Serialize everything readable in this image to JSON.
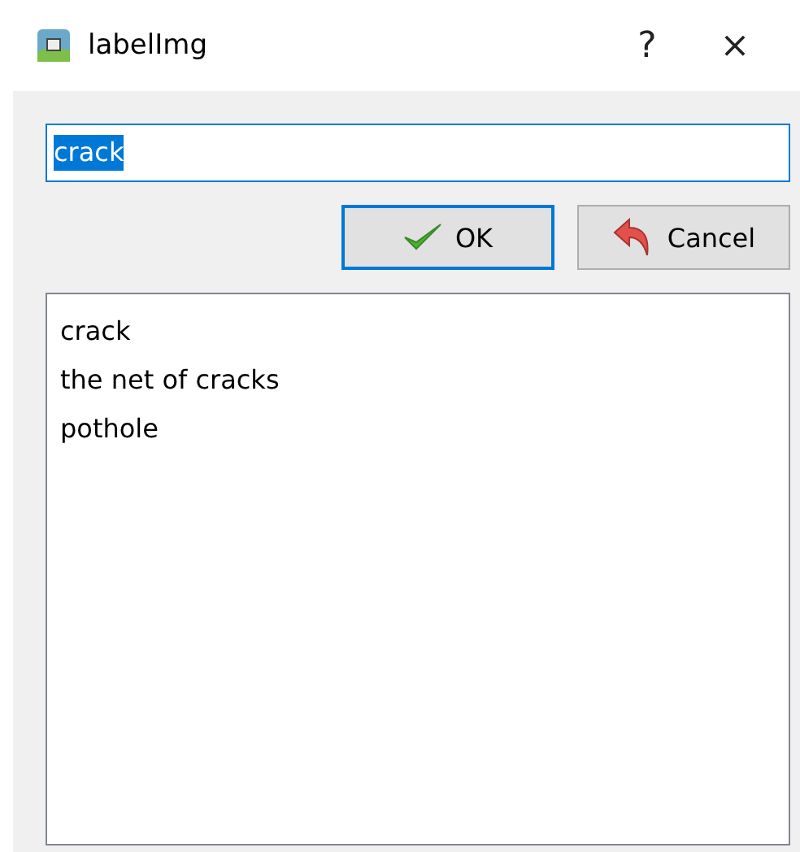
{
  "window": {
    "title": "labelImg",
    "help": "?",
    "close": "×"
  },
  "input": {
    "value": "crack",
    "text_selected": true,
    "focused": true
  },
  "buttons": [
    {
      "kind": "ok",
      "label": "OK",
      "default": true
    },
    {
      "kind": "cancel",
      "label": "Cancel",
      "default": false
    }
  ],
  "list": {
    "items": [
      {
        "label": "crack",
        "selected": false
      },
      {
        "label": "the net of cracks",
        "selected": false
      },
      {
        "label": "pothole",
        "selected": false
      }
    ]
  }
}
